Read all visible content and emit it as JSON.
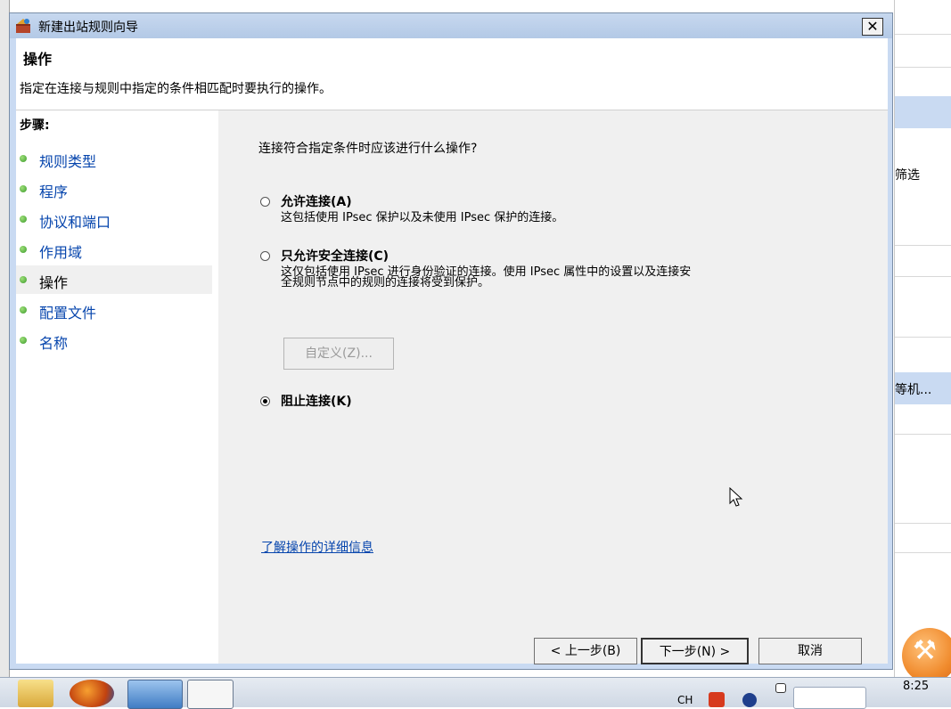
{
  "background_window": {
    "text_filter": "筛选",
    "text_computer": "等机..."
  },
  "dialog": {
    "title": "新建出站规则向导",
    "close_label": "✕",
    "header_title": "操作",
    "header_desc": "指定在连接与规则中指定的条件相匹配时要执行的操作。"
  },
  "steps": {
    "title": "步骤:",
    "items": [
      {
        "label": "规则类型"
      },
      {
        "label": "程序"
      },
      {
        "label": "协议和端口"
      },
      {
        "label": "作用域"
      },
      {
        "label": "操作"
      },
      {
        "label": "配置文件"
      },
      {
        "label": "名称"
      }
    ],
    "active_index": 4
  },
  "content": {
    "question": "连接符合指定条件时应该进行什么操作?",
    "options": [
      {
        "label": "允许连接(A)",
        "desc": "这包括使用 IPsec 保护以及未使用 IPsec 保护的连接。",
        "checked": false
      },
      {
        "label": "只允许安全连接(C)",
        "desc_line1": "这仅包括使用 IPsec 进行身份验证的连接。使用 IPsec 属性中的设置以及连接安",
        "desc_line2": "全规则节点中的规则的连接将受到保护。",
        "checked": false
      },
      {
        "label": "阻止连接(K)",
        "checked": true
      }
    ],
    "customize_label": "自定义(Z)...",
    "learn_more": "了解操作的详细信息"
  },
  "buttons": {
    "back": "< 上一步(B)",
    "next": "下一步(N) >",
    "cancel": "取消"
  },
  "taskbar": {
    "tray_lang": "CH",
    "clock": "8:25",
    "icons": [
      "folder-icon",
      "firefox-icon",
      "server-manager-icon",
      "window-icon"
    ]
  },
  "colors": {
    "titlebar": "#c7d8ef",
    "link": "#0645ad",
    "content_bg": "#f0f0f0"
  }
}
